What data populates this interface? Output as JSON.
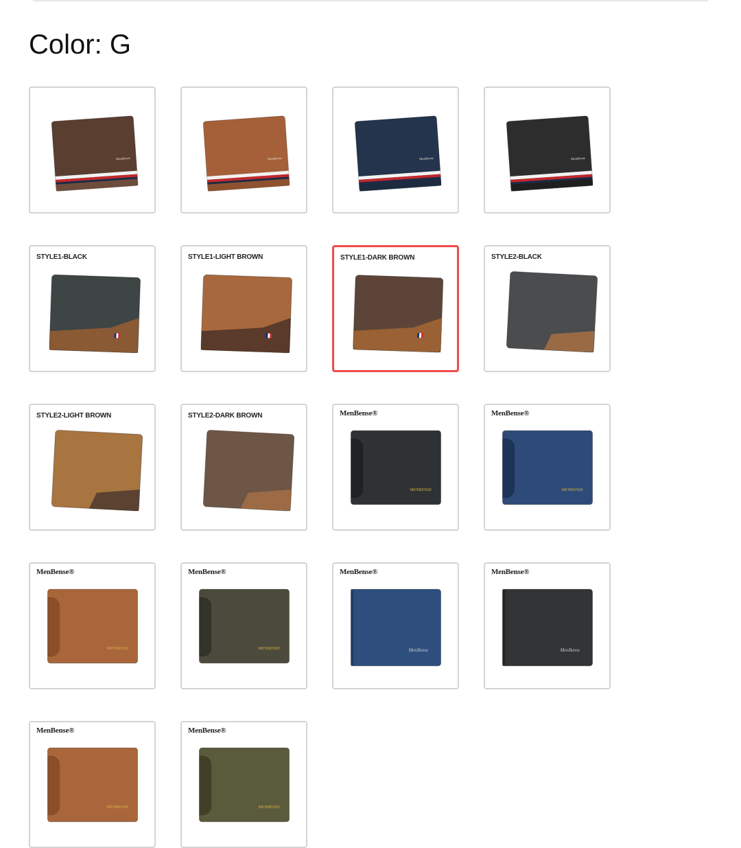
{
  "selector": {
    "heading": "Color: G"
  },
  "swatches": [
    {
      "label": "",
      "kind": "stripe",
      "color": "#5a3e30",
      "accent": "#6d4c3b",
      "selected": false
    },
    {
      "label": "",
      "kind": "stripe",
      "color": "#a5603a",
      "accent": "#8e5230",
      "selected": false
    },
    {
      "label": "",
      "kind": "stripe",
      "color": "#23344c",
      "accent": "#1d2b40",
      "selected": false
    },
    {
      "label": "",
      "kind": "stripe",
      "color": "#2d2d2d",
      "accent": "#1f1f1f",
      "selected": false
    },
    {
      "label": "STYLE1-BLACK",
      "kind": "style1",
      "color": "#3f4544",
      "accent": "#8a5a35",
      "selected": false
    },
    {
      "label": "STYLE1-LIGHT BROWN",
      "kind": "style1",
      "color": "#a8683e",
      "accent": "#5a3a2a",
      "selected": false
    },
    {
      "label": "STYLE1-DARK BROWN",
      "kind": "style1",
      "color": "#5c4538",
      "accent": "#9a6234",
      "selected": true
    },
    {
      "label": "STYLE2-BLACK",
      "kind": "style2",
      "color": "#4a4c4e",
      "accent": "#9a6a45",
      "selected": false
    },
    {
      "label": "STYLE2-LIGHT BROWN",
      "kind": "style2",
      "color": "#a8743f",
      "accent": "#5c4331",
      "selected": false
    },
    {
      "label": "STYLE2-DARK BROWN",
      "kind": "style2",
      "color": "#6e5646",
      "accent": "#9c6b45",
      "selected": false
    },
    {
      "label": "MenBense®",
      "kind": "card",
      "color": "#2e3234",
      "accent": "#1e2224",
      "selected": false
    },
    {
      "label": "MenBense®",
      "kind": "card",
      "color": "#2e4a78",
      "accent": "#1e3358",
      "selected": false
    },
    {
      "label": "MenBense®",
      "kind": "card",
      "color": "#a9663a",
      "accent": "#8a4e28",
      "selected": false
    },
    {
      "label": "MenBense®",
      "kind": "card",
      "color": "#4b4a3c",
      "accent": "#34332a",
      "selected": false
    },
    {
      "label": "MenBense®",
      "kind": "plain",
      "color": "#2e4f7e",
      "accent": "#223d62",
      "selected": false
    },
    {
      "label": "MenBense®",
      "kind": "plain",
      "color": "#333435",
      "accent": "#242526",
      "selected": false
    },
    {
      "label": "MenBense®",
      "kind": "card",
      "color": "#a9663a",
      "accent": "#8a4e28",
      "selected": false
    },
    {
      "label": "MenBense®",
      "kind": "card",
      "color": "#5a5a3c",
      "accent": "#404028",
      "selected": false
    }
  ]
}
